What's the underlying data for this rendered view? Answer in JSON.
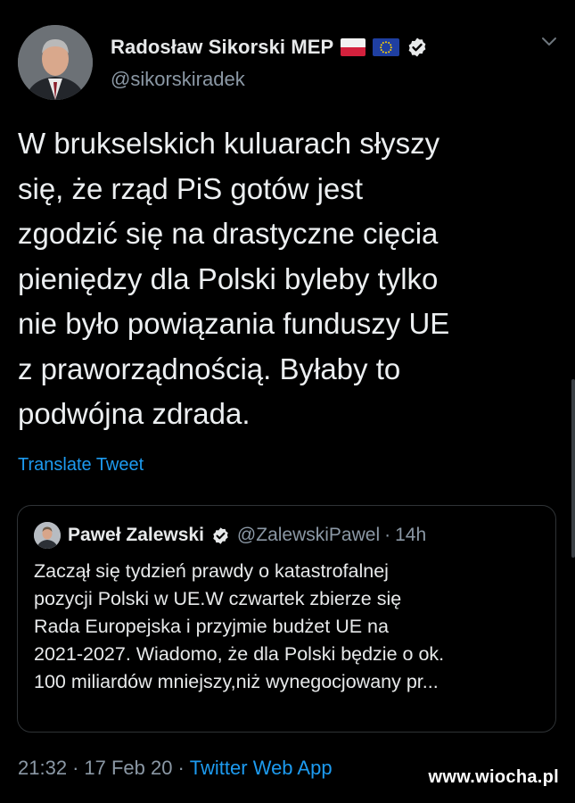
{
  "tweet": {
    "author_name": "Radosław Sikorski MEP",
    "author_handle": "@sikorskiradek",
    "flags": [
      "flag-poland-icon",
      "flag-eu-icon"
    ],
    "verified_icon": "verified-badge-icon",
    "text": "W brukselskich kuluarach słyszy\nsię, że rząd PiS gotów jest\nzgodzić się na drastyczne cięcia\npieniędzy dla Polski byleby tylko\nnie było powiązania funduszy UE\nz praworządnością.  Byłaby to\npodwójna zdrada.",
    "translate_label": "Translate Tweet",
    "time": "21:32",
    "date": "17 Feb 20",
    "separator": "·",
    "source_app": "Twitter Web App"
  },
  "quote": {
    "author_name": "Paweł Zalewski",
    "author_handle": "@ZalewskiPawel",
    "separator": "·",
    "age": "14h",
    "text": "Zaczął się tydzień prawdy o katastrofalnej\npozycji Polski w UE.W czwartek zbierze się\nRada Europejska i przyjmie budżet UE na\n2021-2027. Wiadomo, że dla Polski będzie o ok.\n100 miliardów mniejszy,niż wynegocjowany pr..."
  },
  "watermark": "www.wiocha.pl",
  "colors": {
    "background": "#000000",
    "link": "#1d9bf0",
    "muted": "#8b98a5",
    "text": "#e7e9ea"
  }
}
